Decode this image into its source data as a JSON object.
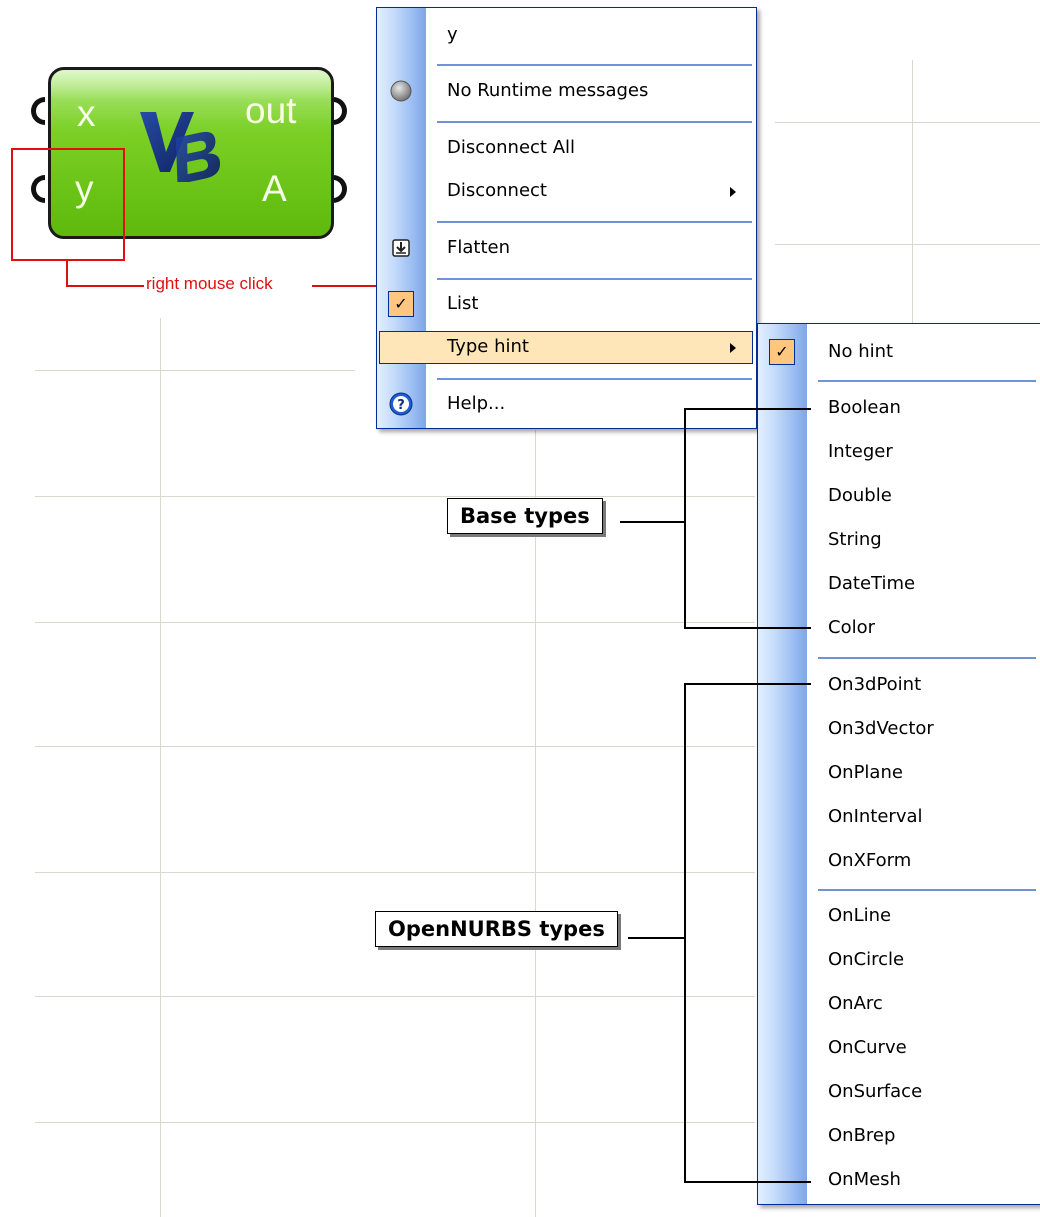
{
  "component": {
    "inputs": [
      "x",
      "y"
    ],
    "outputs": [
      "out",
      "A"
    ],
    "logo": "VB"
  },
  "annotation": {
    "click_label": "right mouse click",
    "base_types_label": "Base types",
    "opennurbs_types_label": "OpenNURBS types"
  },
  "context_menu": {
    "name_value": "y",
    "items": {
      "runtime": "No Runtime messages",
      "disconnect_all": "Disconnect All",
      "disconnect": "Disconnect",
      "flatten": "Flatten",
      "list": "List",
      "type_hint": "Type hint",
      "help": "Help..."
    },
    "list_checked": true
  },
  "submenu": {
    "no_hint": "No hint",
    "base_types": [
      "Boolean",
      "Integer",
      "Double",
      "String",
      "DateTime",
      "Color"
    ],
    "point_types": [
      "On3dPoint",
      "On3dVector",
      "OnPlane",
      "OnInterval",
      "OnXForm"
    ],
    "geometry_types": [
      "OnLine",
      "OnCircle",
      "OnArc",
      "OnCurve",
      "OnSurface",
      "OnBrep",
      "OnMesh"
    ],
    "selected": "No hint"
  },
  "icons": {
    "runtime": "gray-circle-icon",
    "flatten": "flatten-arrow-icon",
    "list": "checkmark-icon",
    "help": "help-question-icon"
  },
  "colors": {
    "accent_border": "#002d96",
    "highlight": "#ffe6b8",
    "check_bg": "#ffc680",
    "annotation_red": "#e01010",
    "component_green": "#7cd026"
  }
}
